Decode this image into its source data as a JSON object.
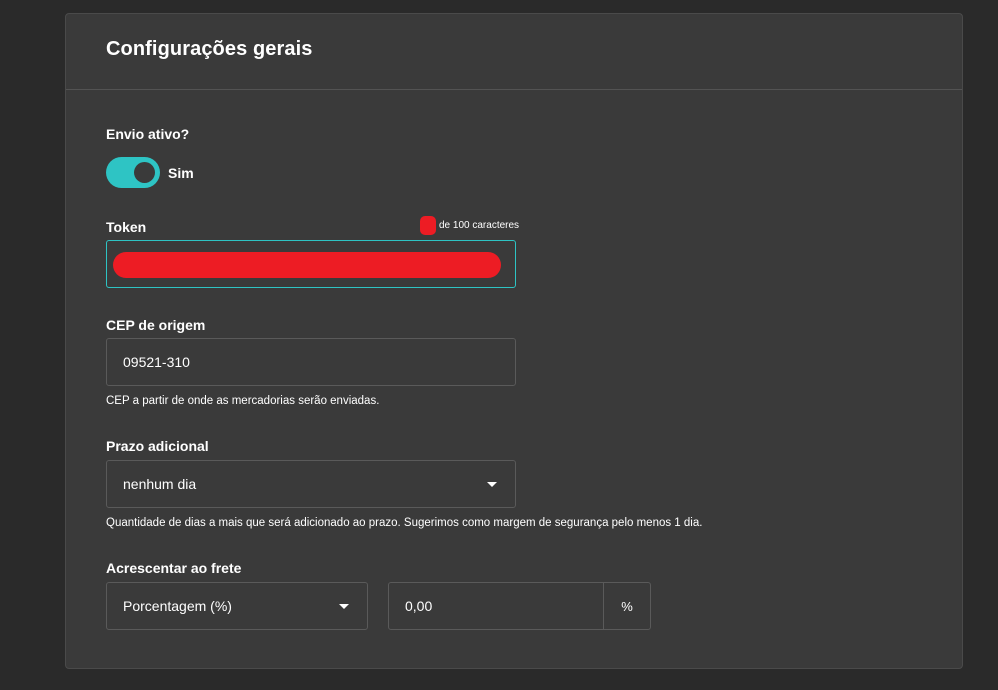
{
  "section": {
    "title": "Configurações gerais"
  },
  "shipping_active": {
    "label": "Envio ativo?",
    "toggle_on": true,
    "toggle_label": "Sim",
    "accent_color": "#2ec4c4"
  },
  "token": {
    "label": "Token",
    "counter_suffix": "de 100 caracteres"
  },
  "origin_cep": {
    "label": "CEP de origem",
    "value": "09521-310",
    "helper": "CEP a partir de onde as mercadorias serão enviadas."
  },
  "additional_time": {
    "label": "Prazo adicional",
    "selected": "nenhum dia",
    "helper": "Quantidade de dias a mais que será adicionado ao prazo. Sugerimos como margem de segurança pelo menos 1 dia."
  },
  "shipping_surcharge": {
    "label": "Acrescentar ao frete",
    "type_selected": "Porcentagem (%)",
    "value": "0,00",
    "unit": "%"
  }
}
